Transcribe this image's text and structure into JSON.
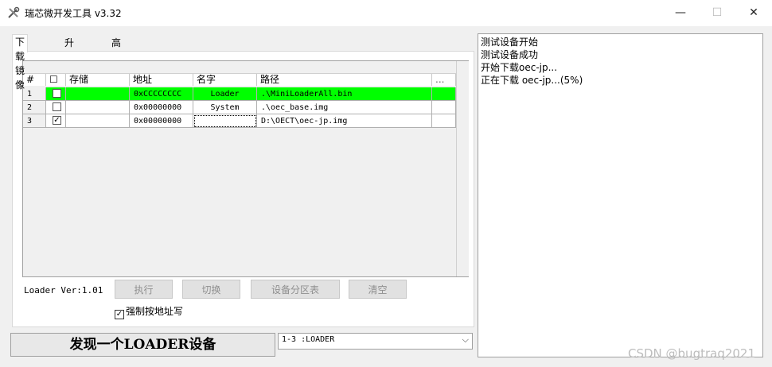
{
  "window": {
    "title": "瑞芯微开发工具 v3.32",
    "app_icon": "tools-icon",
    "min": "—",
    "max": "☐",
    "close": "✕"
  },
  "tabs": [
    {
      "label": "下载镜像",
      "active": true
    },
    {
      "label": "升级固件",
      "active": false
    },
    {
      "label": "高级功能",
      "active": false
    }
  ],
  "table": {
    "columns": {
      "idx": "#",
      "check": "☐",
      "storage": "存储",
      "address": "地址",
      "name": "名字",
      "path": "路径",
      "more": "..."
    },
    "rows": [
      {
        "idx": "1",
        "checked": "",
        "storage": "",
        "address": "0xCCCCCCCC",
        "name": "Loader",
        "path": ".\\MiniLoaderAll.bin"
      },
      {
        "idx": "2",
        "checked": "",
        "storage": "",
        "address": "0x00000000",
        "name": "System",
        "path": ".\\oec_base.img"
      },
      {
        "idx": "3",
        "checked": "✓",
        "storage": "",
        "address": "0x00000000",
        "name": "",
        "path": "D:\\OECT\\oec-jp.img"
      }
    ]
  },
  "loader_version": "Loader Ver:1.01",
  "buttons": {
    "run": "执行",
    "switch": "切换",
    "partition_table": "设备分区表",
    "clear": "清空"
  },
  "force_write": {
    "checked": "✓",
    "label": "强制按地址写"
  },
  "status_text": "发现一个LOADER设备",
  "device_select": {
    "value": "1-3 :LOADER",
    "arrow": "⌵"
  },
  "log_lines": [
    "测试设备开始",
    "测试设备成功",
    "开始下载oec-jp...",
    "正在下载 oec-jp...(5%)"
  ],
  "watermark": "CSDN @bugtraq2021"
}
